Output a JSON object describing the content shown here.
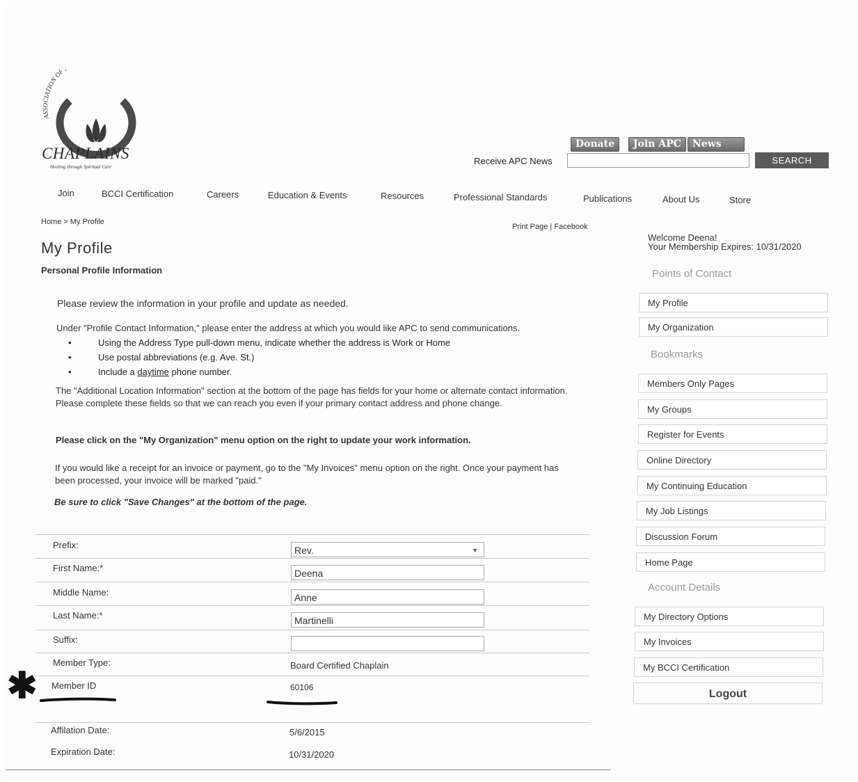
{
  "logo": {
    "arc_text": "ASSOCIATION OF PROFESSIONAL",
    "word": "CHAPLAINS",
    "tagline": "Healing through Spiritual Care"
  },
  "header": {
    "buttons": [
      "Donate",
      "Join APC",
      "News"
    ],
    "news_label": "Receive APC News",
    "news_input_value": "",
    "search_label": "SEARCH"
  },
  "nav": [
    "Join",
    "BCCI Certification",
    "Careers",
    "Education & Events",
    "Resources",
    "Professional Standards",
    "Publications",
    "About Us",
    "Store"
  ],
  "breadcrumb": "Home > My Profile",
  "print_bar": "Print Page | Facebook",
  "page": {
    "title": "My Profile",
    "subtitle": "Personal Profile Information",
    "intro": "Please review the information in your profile and update as needed.",
    "instruction": "Under \"Profile Contact Information,\" please enter the address at which you would like APC to send communications.",
    "bullets": [
      "Using the Address Type pull-down menu, indicate whether the address is Work or Home",
      "Use postal abbreviations (e.g. Ave. St.)"
    ],
    "bullet3_prefix": "Include a ",
    "bullet3_underlined": "daytime",
    "bullet3_suffix": " phone number.",
    "additional": "The \"Additional Location Information\" section at the bottom of the page has fields for your home or alternate contact information. Please complete these fields so that we can reach you even if your primary contact address and phone change.",
    "org_note": "Please click on the \"My Organization\" menu option on the right to update your work information.",
    "invoice_note": "If you would like a receipt for an invoice or payment, go to the \"My Invoices\" menu option on the right. Once your payment has been processed, your invoice will be marked \"paid.\"",
    "save_note": "Be sure to click \"Save Changes\" at the bottom of the page."
  },
  "form": {
    "prefix_label": "Prefix:",
    "prefix_value": "Rev.",
    "first_label": "First Name:*",
    "first_value": "Deena",
    "middle_label": "Middle Name:",
    "middle_value": "Anne",
    "last_label": "Last Name:*",
    "last_value": "Martinelli",
    "suffix_label": "Suffix:",
    "suffix_value": "",
    "member_type_label": "Member Type:",
    "member_type_value": "Board Certified Chaplain",
    "member_id_label": "Member ID",
    "member_id_value": "60106",
    "affiliation_label": "Affilation Date:",
    "affiliation_value": "5/6/2015",
    "expiration_label": "Expiration Date:",
    "expiration_value": "10/31/2020"
  },
  "sidebar": {
    "welcome_line1": "Welcome Deena!",
    "welcome_line2": "Your Membership Expires: 10/31/2020",
    "points_heading": "Points of Contact",
    "points_items": [
      "My Profile",
      "My Organization"
    ],
    "bookmarks_heading": "Bookmarks",
    "bookmarks_items": [
      "Members Only Pages",
      "My Groups",
      "Register for Events",
      "Online Directory",
      "My Continuing Education",
      "My Job Listings",
      "Discussion Forum",
      "Home Page"
    ],
    "account_heading": "Account Details",
    "account_items": [
      "My Directory Options",
      "My Invoices",
      "My BCCI Certification"
    ],
    "logout_label": "Logout"
  },
  "annotation_mark": "✱"
}
